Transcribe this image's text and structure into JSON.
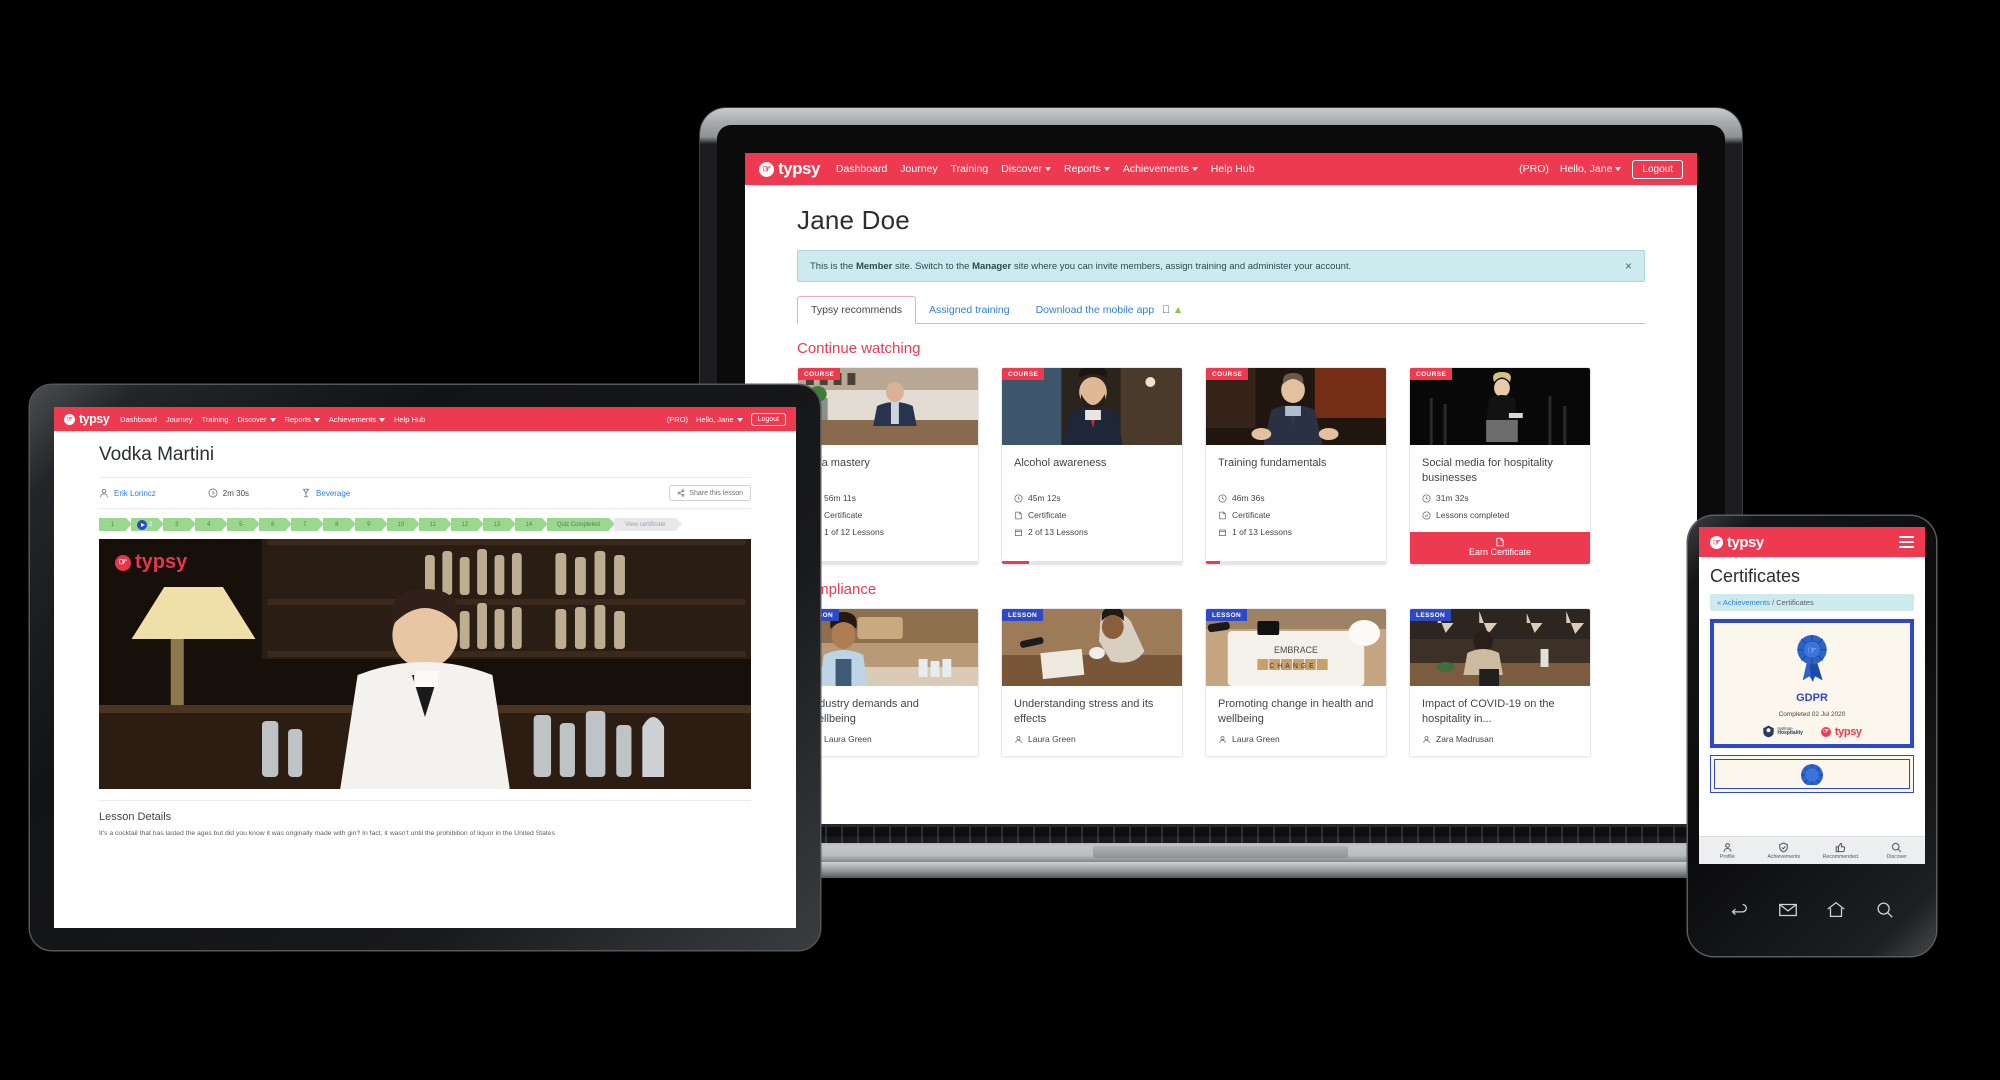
{
  "brand": {
    "name": "typsy",
    "accent": "#ee3a51",
    "lesson_badge_color": "#2f49c4",
    "link_color": "#2f7fd6"
  },
  "laptop": {
    "nav": {
      "logo": "typsy",
      "links": [
        {
          "label": "Dashboard",
          "caret": false
        },
        {
          "label": "Journey",
          "caret": false
        },
        {
          "label": "Training",
          "caret": false
        },
        {
          "label": "Discover",
          "caret": true
        },
        {
          "label": "Reports",
          "caret": true
        },
        {
          "label": "Achievements",
          "caret": true
        },
        {
          "label": "Help Hub",
          "caret": false
        }
      ],
      "plan": "(PRO)",
      "greeting": "Hello, Jane",
      "logout": "Logout"
    },
    "page_title": "Jane Doe",
    "notice": {
      "prefix": "This is the ",
      "bold1": "Member",
      "mid": " site. Switch to the ",
      "bold2": "Manager",
      "suffix": " site where you can invite members, assign training and administer your account.",
      "close": "×"
    },
    "tabs": [
      {
        "label": "Typsy recommends",
        "active": true
      },
      {
        "label": "Assigned training",
        "active": false
      },
      {
        "label": "Download the mobile app",
        "active": false
      }
    ],
    "sections": [
      {
        "title": "Continue watching",
        "cards": [
          {
            "badge": "COURSE",
            "badge_type": "course",
            "name": "Tea mastery",
            "duration": "56m 11s",
            "certificate": "Certificate",
            "lessons": "1 of 12 Lessons",
            "progress_pct": 8,
            "thumb": "barista-counter"
          },
          {
            "badge": "COURSE",
            "badge_type": "course",
            "name": "Alcohol awareness",
            "duration": "45m 12s",
            "certificate": "Certificate",
            "lessons": "2 of 13 Lessons",
            "progress_pct": 15,
            "thumb": "bearded-man-bar"
          },
          {
            "badge": "COURSE",
            "badge_type": "course",
            "name": "Training fundamentals",
            "duration": "46m 36s",
            "certificate": "Certificate",
            "lessons": "1 of 13 Lessons",
            "progress_pct": 8,
            "thumb": "suited-presenter"
          },
          {
            "badge": "COURSE",
            "badge_type": "course",
            "name": "Social media for hospitality businesses",
            "duration": "31m 32s",
            "completed": "Lessons completed",
            "earn_label": "Earn Certificate",
            "thumb": "stage-speaker"
          }
        ]
      },
      {
        "title": "Compliance",
        "cards": [
          {
            "badge": "LESSON",
            "badge_type": "lesson",
            "name": "Industry demands and wellbeing",
            "author": "Laura Green",
            "thumb": "smiling-barista"
          },
          {
            "badge": "LESSON",
            "badge_type": "lesson",
            "name": "Understanding stress and its effects",
            "author": "Laura Green",
            "thumb": "stressed-desk"
          },
          {
            "badge": "LESSON",
            "badge_type": "lesson",
            "name": "Promoting change in health and wellbeing",
            "author": "Laura Green",
            "thumb": "embrace-change"
          },
          {
            "badge": "LESSON",
            "badge_type": "lesson",
            "name": "Impact of COVID-19 on the hospitality in...",
            "author": "Zara Madrusan",
            "thumb": "empty-restaurant"
          }
        ]
      }
    ]
  },
  "tablet": {
    "nav": {
      "logo": "typsy",
      "links": [
        {
          "label": "Dashboard",
          "caret": false
        },
        {
          "label": "Journey",
          "caret": false
        },
        {
          "label": "Training",
          "caret": false
        },
        {
          "label": "Discover",
          "caret": true
        },
        {
          "label": "Reports",
          "caret": true
        },
        {
          "label": "Achievements",
          "caret": true
        },
        {
          "label": "Help Hub",
          "caret": false
        }
      ],
      "plan": "(PRO)",
      "greeting": "Hello, Jane",
      "logout": "Logout"
    },
    "lesson_title": "Vodka Martini",
    "instructor": "Erik Lorincz",
    "duration": "2m 30s",
    "category": "Beverage",
    "share_label": "Share this lesson",
    "steps": [
      "1",
      "2",
      "3",
      "4",
      "5",
      "6",
      "7",
      "8",
      "9",
      "10",
      "11",
      "12",
      "13",
      "14"
    ],
    "current_step": "2",
    "quiz_label": "Quiz Completed",
    "certificate_label": "View certificate",
    "details_heading": "Lesson Details",
    "details_text": "It's a cocktail that has lasted the ages but did you know it was originally made with gin? In fact, it wasn't until the prohibition of liquor in the United States"
  },
  "phone": {
    "logo": "typsy",
    "menu_icon": "hamburger-icon",
    "page_title": "Certificates",
    "breadcrumb_back": "« Achievements",
    "breadcrumb_sep": " / ",
    "breadcrumb_current": "Certificates",
    "certificates": [
      {
        "name": "GDPR",
        "completed": "Completed 02 Jul 2020",
        "issuer": "Institute of Hospitality",
        "brand": "typsy"
      }
    ],
    "tabbar": [
      {
        "label": "Profile",
        "icon": "person-icon"
      },
      {
        "label": "Achievements",
        "icon": "shield-check-icon"
      },
      {
        "label": "Recommended",
        "icon": "thumbs-up-icon"
      },
      {
        "label": "Discover",
        "icon": "search-icon"
      }
    ],
    "hardware_buttons": [
      "back-icon",
      "mail-icon",
      "home-icon",
      "search-icon"
    ]
  }
}
